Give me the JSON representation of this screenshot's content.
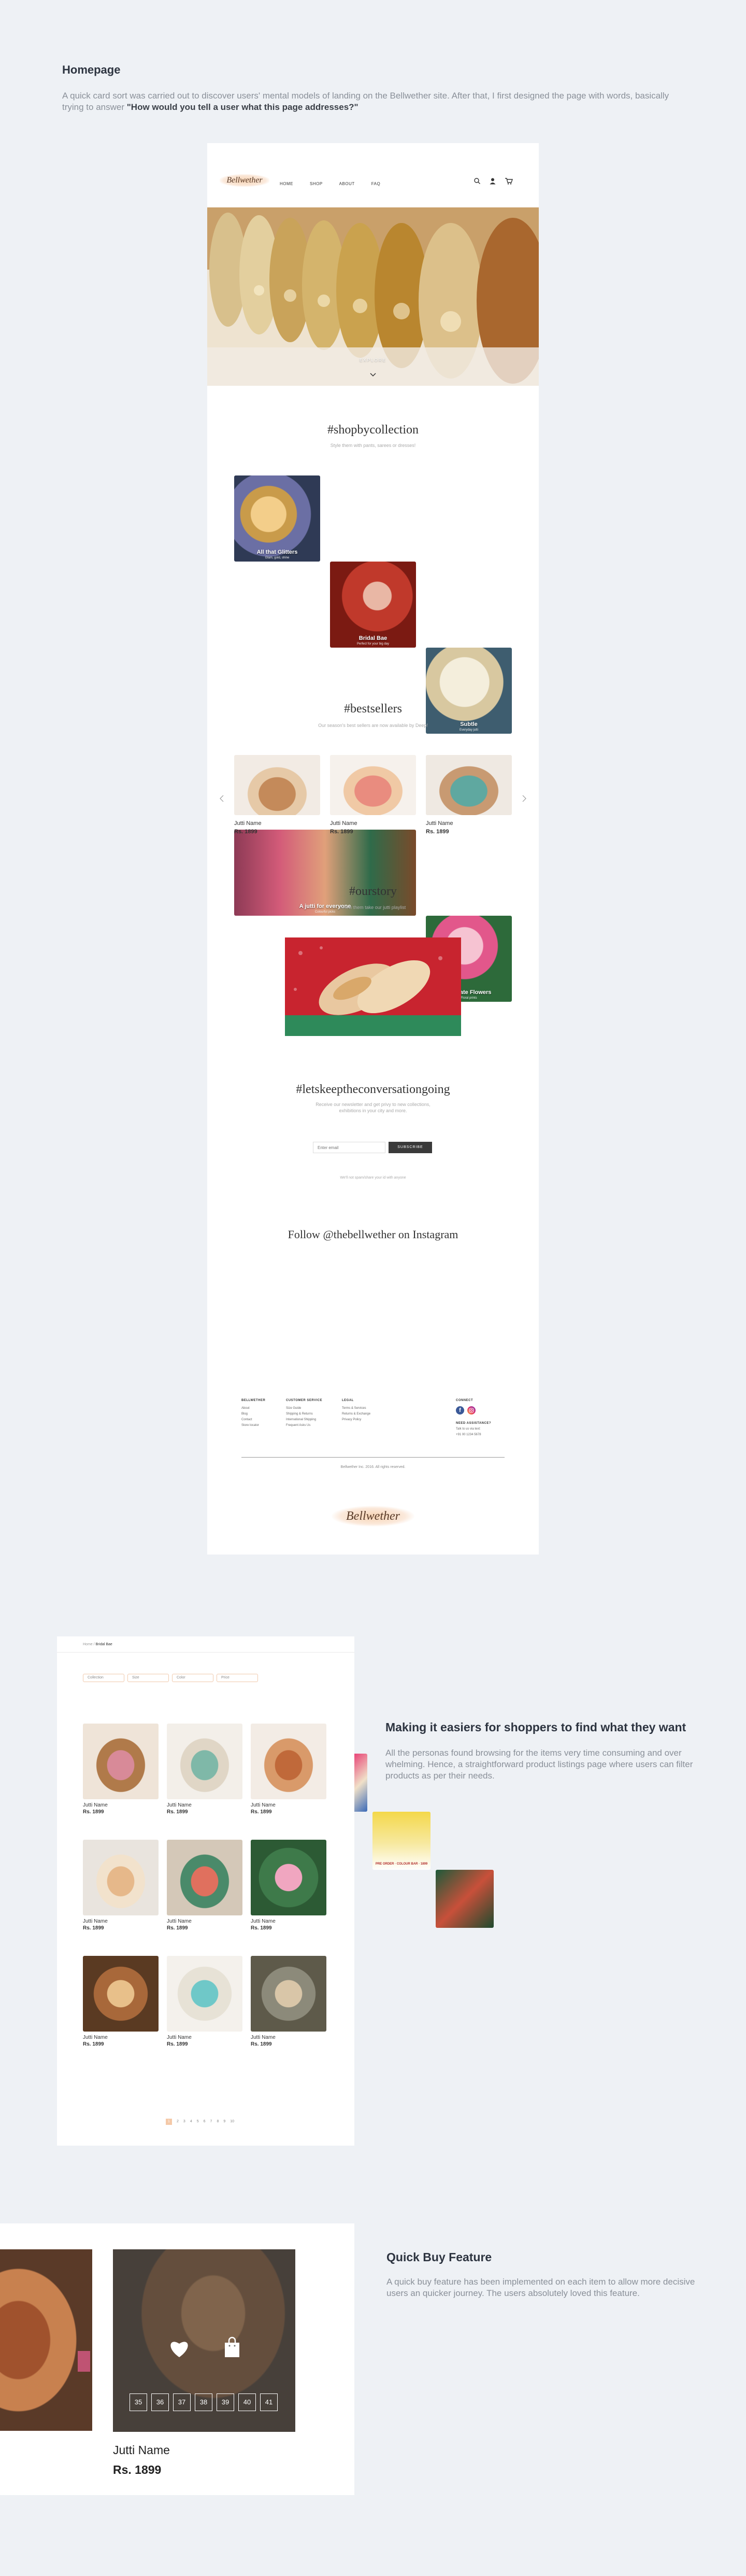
{
  "intro": {
    "title": "Homepage",
    "text_plain": "A quick card sort was carried out to discover users' mental models of landing on the Bellwether site. After that, I first designed the page with words, basically trying to answer ",
    "text_bold": "\"How would you tell a user what this page addresses?\""
  },
  "site": {
    "logo": "Bellwether",
    "nav": [
      "HOME",
      "SHOP",
      "ABOUT",
      "FAQ"
    ],
    "hero_label": "EXPLORE"
  },
  "collection": {
    "title": "#shopbycollection",
    "subtitle": "Style them with pants, sarees or dresses!",
    "tiles": [
      {
        "label": "All that Glitters",
        "sub": "Glam, gold, shine"
      },
      {
        "label": "Bridal Bae",
        "sub": "Perfect for your big day"
      },
      {
        "label": "Subtle",
        "sub": "Everyday jutti"
      },
      {
        "label": "A jutti for everyone",
        "sub": "Colourful picks"
      },
      {
        "label": "Delicate Flowers",
        "sub": "Floral prints"
      }
    ]
  },
  "bestsellers": {
    "title": "#bestsellers",
    "subtitle": "Our season's best sellers are now available by Deep!",
    "items": [
      {
        "name": "Jutti Name",
        "price": "Rs. 1899"
      },
      {
        "name": "Jutti Name",
        "price": "Rs. 1899"
      },
      {
        "name": "Jutti Name",
        "price": "Rs. 1899"
      }
    ]
  },
  "story": {
    "title": "#ourstory",
    "subtitle": "Know them take our jutti playlist"
  },
  "newsletter": {
    "title": "#letskeeptheconversationgoing",
    "subtitle_1": "Receive our newsletter and get privy to new collections,",
    "subtitle_2": "exhibitions in your city and more.",
    "placeholder": "Enter email",
    "button": "SUBSCRIBE",
    "note": "We'll not spam/share your id with anyone"
  },
  "instagram": {
    "title": "Follow @thebellwether on Instagram",
    "ig_text": "PRE ORDER · COLOUR BAR · 1899"
  },
  "footer": {
    "cols": [
      {
        "head": "BELLWETHER",
        "items": [
          "About",
          "Blog",
          "Contact",
          "Store locator"
        ]
      },
      {
        "head": "CUSTOMER SERVICE",
        "items": [
          "Size Guide",
          "Shipping & Returns",
          "International Shipping",
          "Frequent Asks Us"
        ]
      },
      {
        "head": "LEGAL",
        "items": [
          "Terms & Services",
          "Returns & Exchange",
          "Privacy Policy"
        ]
      },
      {
        "head": "CONNECT",
        "items": []
      }
    ],
    "help_head": "NEED ASSISTANCE?",
    "help_lines": [
      "Talk to us via text:",
      "+91 00 1234 5678"
    ],
    "copyright": "Bellwether Inc. 2016. All rights reserved."
  },
  "plp": {
    "breadcrumb_home": "Home /",
    "breadcrumb_current": "Bridal Bae",
    "filters": [
      "Collection",
      "Size",
      "Color",
      "Price"
    ],
    "items": [
      {
        "name": "Jutti Name",
        "price": "Rs. 1899"
      },
      {
        "name": "Jutti Name",
        "price": "Rs. 1899"
      },
      {
        "name": "Jutti Name",
        "price": "Rs. 1899"
      },
      {
        "name": "Jutti Name",
        "price": "Rs. 1899"
      },
      {
        "name": "Jutti Name",
        "price": "Rs. 1899"
      },
      {
        "name": "Jutti Name",
        "price": "Rs. 1899"
      },
      {
        "name": "Jutti Name",
        "price": "Rs. 1899"
      },
      {
        "name": "Jutti Name",
        "price": "Rs. 1899"
      },
      {
        "name": "Jutti Name",
        "price": "Rs. 1899"
      }
    ],
    "pages": [
      "1",
      "2",
      "3",
      "4",
      "5",
      "6",
      "7",
      "8",
      "9",
      "10"
    ],
    "side_title": "Making it easiers for shoppers to find what they want",
    "side_text": "All the personas found browsing for the items very time consuming and over whelming. Hence, a straightforward product listings page where users can filter products as per their needs."
  },
  "quickbuy": {
    "sizes": [
      "35",
      "36",
      "37",
      "38",
      "39",
      "40",
      "41"
    ],
    "name": "Jutti Name",
    "price": "Rs. 1899",
    "side_title": "Quick Buy Feature",
    "side_text": " A quick buy feature has been implemented on each item to allow more decisive users an quicker journey. The users absolutely loved this feature."
  },
  "colors": {
    "accent": "#e85d2a",
    "page_bg": "#eef1f5",
    "muted_text": "#8a9099",
    "dark_button": "#3a3a3a"
  }
}
